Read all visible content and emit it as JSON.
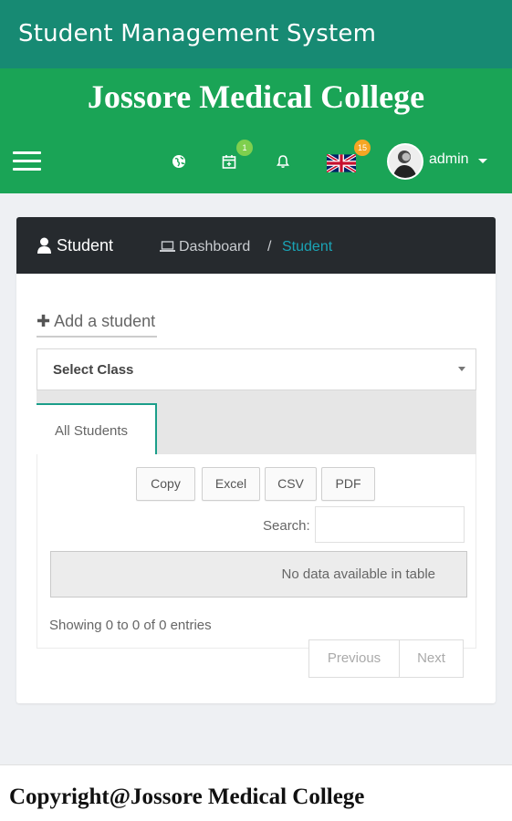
{
  "appbar": {
    "title": "Student Management System"
  },
  "banner": {
    "college_name": "Jossore Medical College"
  },
  "navbar": {
    "menu_icon": "hamburger-icon",
    "icons": [
      "globe-icon",
      "calendar-icon",
      "bell-icon",
      "uk-flag-icon"
    ],
    "calendar_badge": "1",
    "flag_badge": "15",
    "user_name": "admin"
  },
  "card": {
    "header_title": "Student",
    "breadcrumb": {
      "dashboard": "Dashboard",
      "separator": "/",
      "current": "Student"
    },
    "add_student": "Add a student",
    "select_class": {
      "label": "Select Class"
    },
    "tabs": [
      {
        "label": "All Students",
        "active": true
      }
    ],
    "export_buttons": [
      "Copy",
      "Excel",
      "CSV",
      "PDF"
    ],
    "search": {
      "label": "Search:",
      "value": ""
    },
    "table": {
      "empty_message": "No data available in table"
    },
    "info": "Showing 0 to 0 of 0 entries",
    "pagination": {
      "previous": "Previous",
      "next": "Next"
    }
  },
  "footer": {
    "text": "Copyright@Jossore Medical College"
  },
  "colors": {
    "appbar": "#178a73",
    "navbar": "#1aa456",
    "card_header": "#262a2e",
    "accent": "#1aa3b5",
    "badge_green": "#7fcf4e",
    "badge_orange": "#f5a623"
  }
}
